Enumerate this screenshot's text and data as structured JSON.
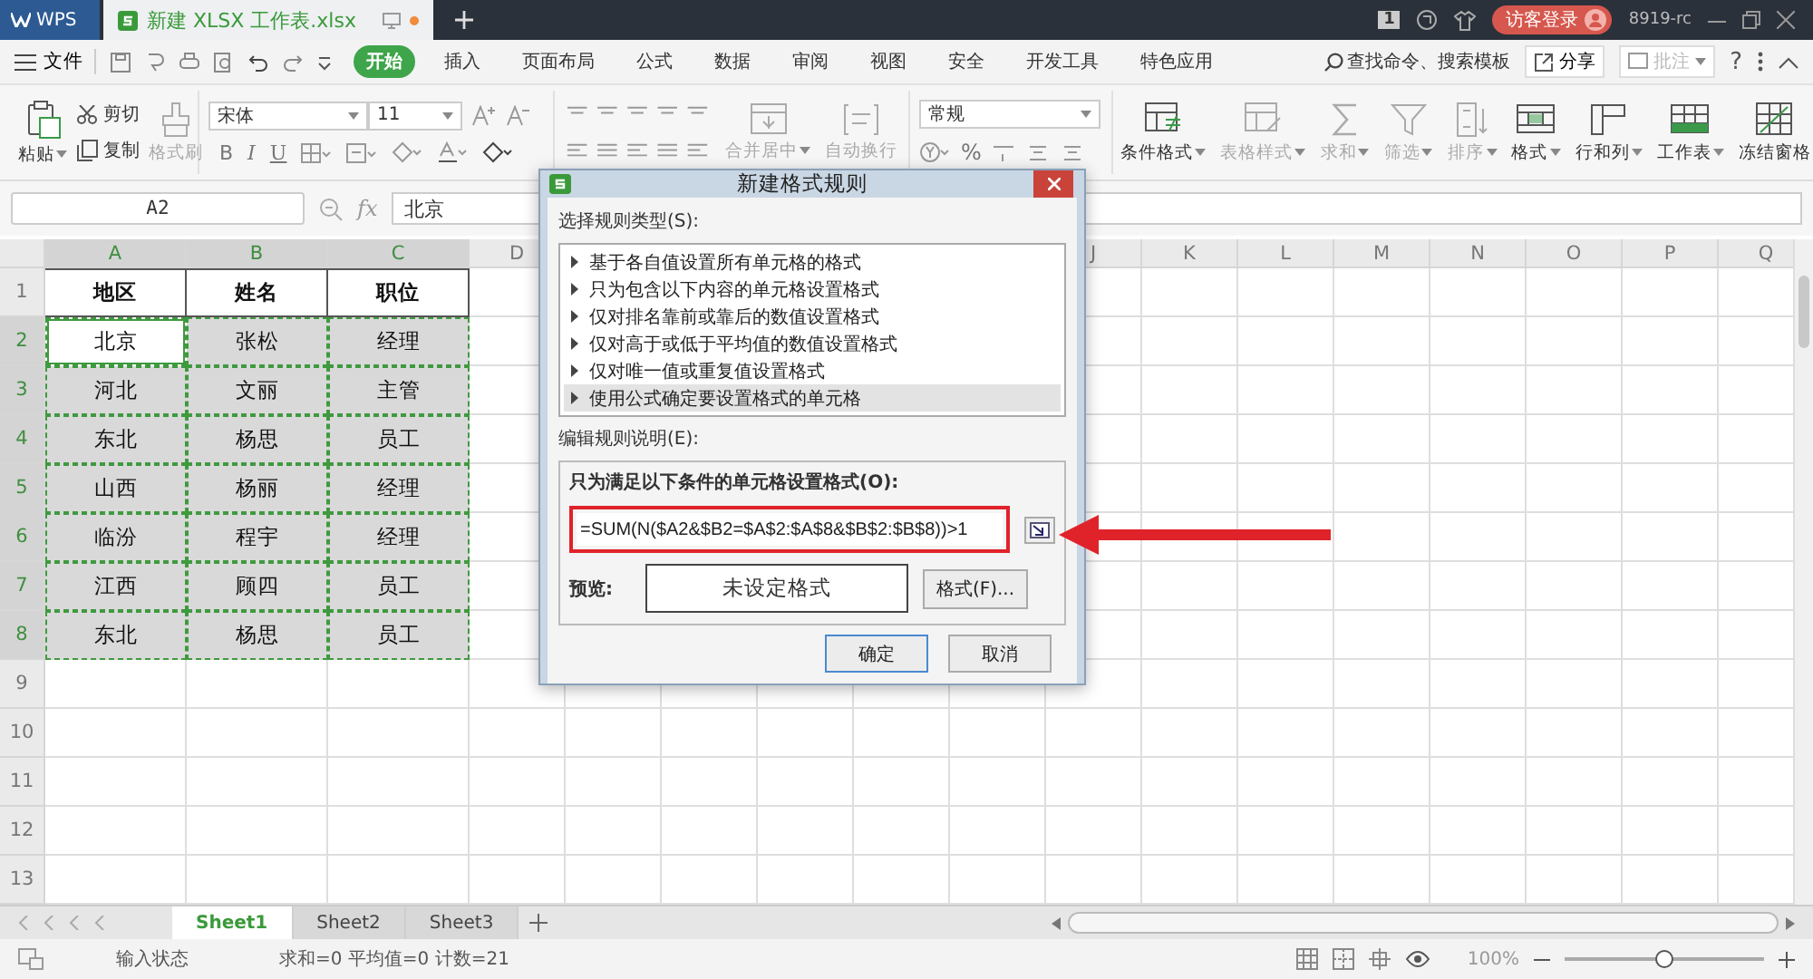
{
  "title_bar": {
    "app_tab": "WPS",
    "file_tab": "新建 XLSX 工作表.xlsx",
    "unsaved": true,
    "badge": "1",
    "login_button": "访客登录",
    "user": "8919-rc"
  },
  "menu": {
    "file": "文件",
    "tabs": [
      {
        "label": "开始",
        "selected": true
      },
      {
        "label": "插入",
        "selected": false
      },
      {
        "label": "页面布局",
        "selected": false
      },
      {
        "label": "公式",
        "selected": false
      },
      {
        "label": "数据",
        "selected": false
      },
      {
        "label": "审阅",
        "selected": false
      },
      {
        "label": "视图",
        "selected": false
      },
      {
        "label": "安全",
        "selected": false
      },
      {
        "label": "开发工具",
        "selected": false
      },
      {
        "label": "特色应用",
        "selected": false
      }
    ],
    "search": "查找命令、搜索模板",
    "share": "分享",
    "comment": {
      "label": "批注",
      "disabled": true
    },
    "help": "?"
  },
  "ribbon": {
    "paste": "粘贴",
    "cut": "剪切",
    "copy": "复制",
    "painter": {
      "label": "格式刷",
      "disabled": true
    },
    "font": "宋体",
    "size": "11",
    "bold": "B",
    "italic": "I",
    "underline": "U",
    "merge": {
      "label": "合并居中",
      "disabled": true
    },
    "wrap": {
      "label": "自动换行",
      "disabled": true
    },
    "number_format": "常规",
    "percent": "%",
    "tools": [
      {
        "label": "条件格式",
        "disabled": false
      },
      {
        "label": "表格样式",
        "disabled": true
      },
      {
        "label": "求和",
        "disabled": true
      },
      {
        "label": "筛选",
        "disabled": true
      },
      {
        "label": "排序",
        "disabled": true
      },
      {
        "label": "格式",
        "disabled": false
      },
      {
        "label": "行和列",
        "disabled": false
      },
      {
        "label": "工作表",
        "disabled": false
      },
      {
        "label": "冻结窗格",
        "disabled": false
      }
    ]
  },
  "formula_bar": {
    "cell_ref": "A2",
    "fx": "fx",
    "value": "北京"
  },
  "sheet": {
    "columns": [
      {
        "label": "A",
        "selected": true
      },
      {
        "label": "B",
        "selected": true
      },
      {
        "label": "C",
        "selected": true
      },
      {
        "label": "D",
        "selected": false
      },
      {
        "label": "J",
        "selected": false
      },
      {
        "label": "K",
        "selected": false
      },
      {
        "label": "L",
        "selected": false
      },
      {
        "label": "M",
        "selected": false
      },
      {
        "label": "N",
        "selected": false
      },
      {
        "label": "O",
        "selected": false
      },
      {
        "label": "P",
        "selected": false
      },
      {
        "label": "Q",
        "selected": false
      }
    ],
    "rows": [
      {
        "number": "1",
        "bold": true,
        "selected": false,
        "cells": [
          {
            "text": "地区",
            "active": false
          },
          {
            "text": "姓名",
            "active": false
          },
          {
            "text": "职位",
            "active": false
          }
        ]
      },
      {
        "number": "2",
        "bold": false,
        "selected": true,
        "cells": [
          {
            "text": "北京",
            "active": true
          },
          {
            "text": "张松",
            "active": false
          },
          {
            "text": "经理",
            "active": false
          }
        ]
      },
      {
        "number": "3",
        "bold": false,
        "selected": true,
        "cells": [
          {
            "text": "河北",
            "active": false
          },
          {
            "text": "文丽",
            "active": false
          },
          {
            "text": "主管",
            "active": false
          }
        ]
      },
      {
        "number": "4",
        "bold": false,
        "selected": true,
        "cells": [
          {
            "text": "东北",
            "active": false
          },
          {
            "text": "杨思",
            "active": false
          },
          {
            "text": "员工",
            "active": false
          }
        ]
      },
      {
        "number": "5",
        "bold": false,
        "selected": true,
        "cells": [
          {
            "text": "山西",
            "active": false
          },
          {
            "text": "杨丽",
            "active": false
          },
          {
            "text": "经理",
            "active": false
          }
        ]
      },
      {
        "number": "6",
        "bold": false,
        "selected": true,
        "cells": [
          {
            "text": "临汾",
            "active": false
          },
          {
            "text": "程宇",
            "active": false
          },
          {
            "text": "经理",
            "active": false
          }
        ]
      },
      {
        "number": "7",
        "bold": false,
        "selected": true,
        "cells": [
          {
            "text": "江西",
            "active": false
          },
          {
            "text": "顾四",
            "active": false
          },
          {
            "text": "员工",
            "active": false
          }
        ]
      },
      {
        "number": "8",
        "bold": false,
        "selected": true,
        "cells": [
          {
            "text": "东北",
            "active": false
          },
          {
            "text": "杨思",
            "active": false
          },
          {
            "text": "员工",
            "active": false
          }
        ]
      },
      {
        "number": "9",
        "selected": false
      },
      {
        "number": "10",
        "selected": false
      },
      {
        "number": "11",
        "selected": false
      },
      {
        "number": "12",
        "selected": false
      },
      {
        "number": "13",
        "selected": false
      }
    ]
  },
  "dialog": {
    "title": "新建格式规则",
    "rule_type_label": "选择规则类型(S):",
    "rule_types": [
      {
        "label": "基于各自值设置所有单元格的格式",
        "selected": false
      },
      {
        "label": "只为包含以下内容的单元格设置格式",
        "selected": false
      },
      {
        "label": "仅对排名靠前或靠后的数值设置格式",
        "selected": false
      },
      {
        "label": "仅对高于或低于平均值的数值设置格式",
        "selected": false
      },
      {
        "label": "仅对唯一值或重复值设置格式",
        "selected": false
      },
      {
        "label": "使用公式确定要设置格式的单元格",
        "selected": true
      }
    ],
    "edit_label": "编辑规则说明(E):",
    "condition_label": "只为满足以下条件的单元格设置格式(O):",
    "formula": "=SUM(N($A2&$B2=$A$2:$A$8&$B$2:$B$8))>1",
    "preview_label": "预览:",
    "preview": "未设定格式",
    "format_button": "格式(F)...",
    "ok": "确定",
    "cancel": "取消"
  },
  "sheet_tabs": [
    {
      "label": "Sheet1",
      "selected": true
    },
    {
      "label": "Sheet2",
      "selected": false
    },
    {
      "label": "Sheet3",
      "selected": false
    }
  ],
  "status_bar": {
    "mode": "输入状态",
    "stats": "求和=0 平均值=0 计数=21",
    "zoom": "100%",
    "zoom_slider": {
      "level": 0.5
    }
  }
}
